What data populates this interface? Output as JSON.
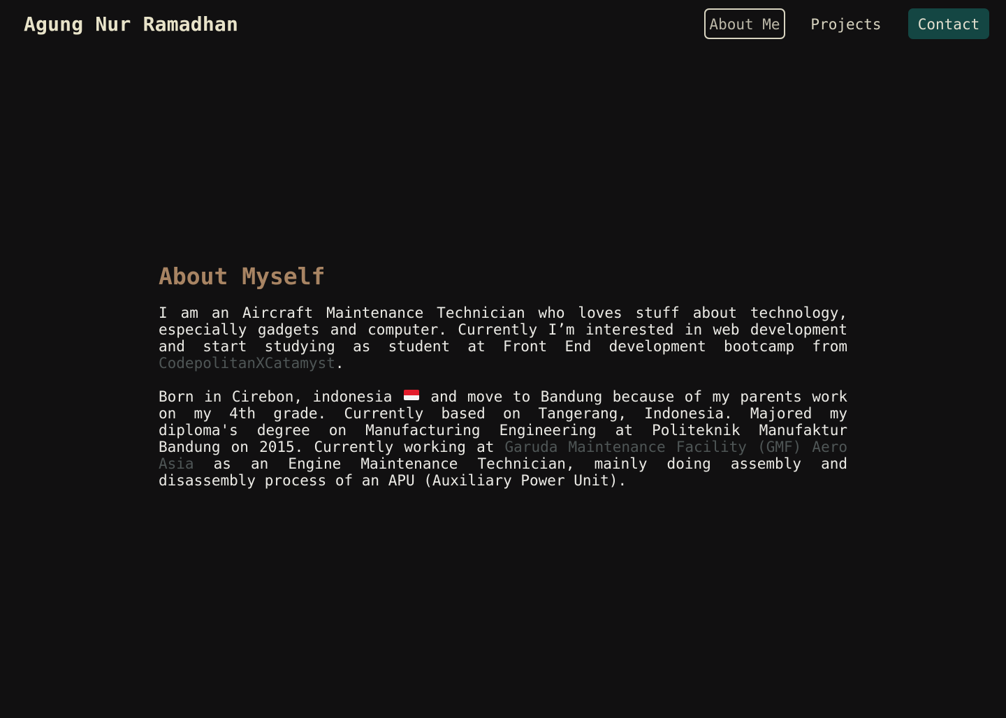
{
  "header": {
    "brand": "Agung Nur Ramadhan",
    "nav": {
      "about": "About Me",
      "projects": "Projects",
      "contact": "Contact"
    }
  },
  "about": {
    "title": "About Myself",
    "p1_text": "I am an Aircraft Maintenance Technician who loves stuff about technology, especially gadgets and computer. Currently I’m interested in web development and start studying as student at Front End development bootcamp from ",
    "p1_link": "CodepolitanXCatamyst",
    "p1_end": ".",
    "p2_text_a": "Born in Cirebon, indonesia ",
    "p2_text_b": " and move to Bandung because of my parents work on my 4th grade. Currently based on Tangerang, Indonesia. Majored my diploma's degree on Manufacturing Engineering at Politeknik Manufaktur Bandung on 2015. Currently working at ",
    "p2_link": "Garuda Maintenance Facility (GMF) Aero Asia",
    "p2_end": " as an Engine Maintenance Technician, mainly doing assembly and disassembly process of an APU (Auxiliary Power Unit).",
    "flag_icon": "indonesia-flag-icon"
  },
  "colors": {
    "background": "#111011",
    "heading": "#a88463",
    "link": "#4f5656",
    "contact_button": "#144643"
  }
}
